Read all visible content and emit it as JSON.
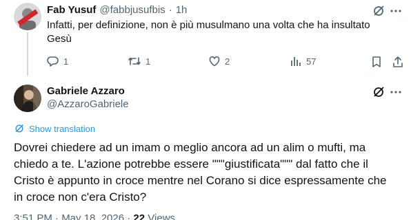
{
  "reply_tweet": {
    "author_name": "Fab Yusuf",
    "author_handle": "@fabbjusufbis",
    "separator": "·",
    "timestamp": "1h",
    "text_line1": "Infatti, per definizione, non è più musulmano una volta che ha insultato",
    "text_line2": "Gesù",
    "actions": {
      "reply_count": "1",
      "retweet_count": "1",
      "like_count": "2",
      "views_count": "57"
    },
    "more_icon": "more-dots-icon",
    "grok_icon": "grok-slash-icon"
  },
  "main_tweet": {
    "author_name": "Gabriele Azzaro",
    "author_handle": "@AzzaroGabriele",
    "show_translation": "Show translation",
    "text_line1": "Dovrei chiedere ad un imam o meglio ancora ad un alim o mufti, ma",
    "text_line2": "chiedo a te. L'azione potrebbe essere \"\"\"giustificata\"\"\" dal fatto che il",
    "text_line3": "Cristo è appunto in croce mentre nel Corano si dice espressamente che",
    "text_line4": "in croce non c'era Cristo?",
    "meta_time": "3:51 PM · May 18, 2026 ·",
    "meta_views": "22",
    "meta_views_label": "Views"
  },
  "colors": {
    "accent": "#1d9bf0",
    "text": "#0f1419",
    "muted": "#536471",
    "divider": "#eff3f4"
  }
}
